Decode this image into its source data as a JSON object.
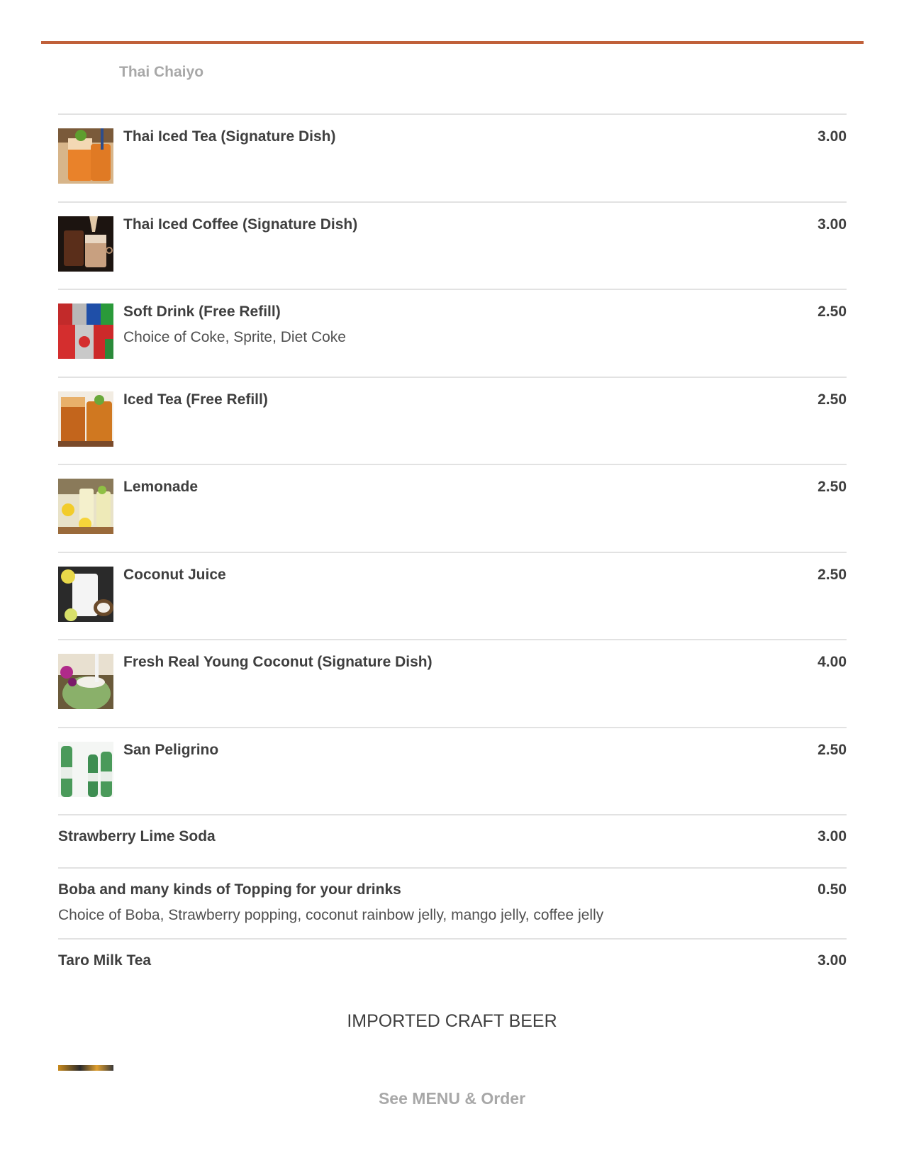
{
  "restaurant": {
    "name": "Thai Chaiyo"
  },
  "items": [
    {
      "name": "Thai Iced Tea (Signature Dish)",
      "price": "3.00",
      "photo": "thai-iced-tea-photo"
    },
    {
      "name": "Thai Iced Coffee (Signature Dish)",
      "price": "3.00",
      "photo": "thai-iced-coffee-photo"
    },
    {
      "name": "Soft Drink (Free Refill)",
      "price": "2.50",
      "description": "Choice of Coke, Sprite, Diet Coke",
      "photo": "soda-cans-photo"
    },
    {
      "name": "Iced Tea (Free Refill)",
      "price": "2.50",
      "photo": "iced-tea-photo"
    },
    {
      "name": "Lemonade",
      "price": "2.50",
      "photo": "lemonade-photo"
    },
    {
      "name": "Coconut Juice",
      "price": "2.50",
      "photo": "coconut-juice-photo"
    },
    {
      "name": "Fresh Real Young Coconut (Signature Dish)",
      "price": "4.00",
      "photo": "young-coconut-photo"
    },
    {
      "name": "San Peligrino",
      "price": "2.50",
      "photo": "sparkling-water-photo"
    },
    {
      "name": "Strawberry Lime Soda",
      "price": "3.00"
    },
    {
      "name": "Boba and many kinds of Topping for your drinks",
      "price": "0.50",
      "description": "Choice of Boba, Strawberry popping, coconut rainbow jelly, mango jelly, coffee jelly"
    },
    {
      "name": "Taro Milk Tea",
      "price": "3.00"
    }
  ],
  "section": {
    "heading": "IMPORTED CRAFT BEER"
  },
  "cta": {
    "label": "See MENU & Order"
  },
  "colors": {
    "accent": "#c0603a",
    "muted_text": "#a8a8a8",
    "text": "#3f3f3f",
    "divider": "#e2e2e2"
  }
}
